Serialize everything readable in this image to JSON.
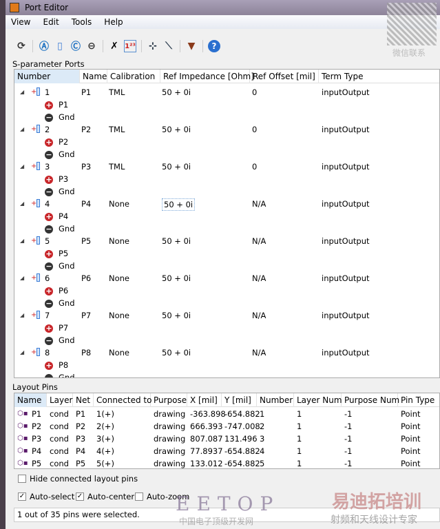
{
  "window": {
    "title": "Port Editor"
  },
  "menu": [
    "View",
    "Edit",
    "Tools",
    "Help"
  ],
  "toolbar": [
    "refresh-icon",
    "add-port-a-icon",
    "add-port-icon",
    "add-port-c-icon",
    "remove-port-icon",
    "delete-icon",
    "renumber-icon",
    "add-pin-icon",
    "remove-pin-icon",
    "filter-icon",
    "help-icon"
  ],
  "sparam": {
    "label": "S-parameter Ports",
    "columns": [
      "Number",
      "Name",
      "Calibration",
      "Ref Impedance [Ohm]",
      "Ref Offset [mil]",
      "Term Type"
    ],
    "ports": [
      {
        "number": "1",
        "name": "P1",
        "calibration": "TML",
        "impedance": "50 + 0i",
        "offset": "0",
        "term": "inputOutput",
        "plus": "P1",
        "minus": "Gnd"
      },
      {
        "number": "2",
        "name": "P2",
        "calibration": "TML",
        "impedance": "50 + 0i",
        "offset": "0",
        "term": "inputOutput",
        "plus": "P2",
        "minus": "Gnd"
      },
      {
        "number": "3",
        "name": "P3",
        "calibration": "TML",
        "impedance": "50 + 0i",
        "offset": "0",
        "term": "inputOutput",
        "plus": "P3",
        "minus": "Gnd"
      },
      {
        "number": "4",
        "name": "P4",
        "calibration": "None",
        "impedance": "50 + 0i",
        "offset": "N/A",
        "term": "inputOutput",
        "plus": "P4",
        "minus": "Gnd"
      },
      {
        "number": "5",
        "name": "P5",
        "calibration": "None",
        "impedance": "50 + 0i",
        "offset": "N/A",
        "term": "inputOutput",
        "plus": "P5",
        "minus": "Gnd"
      },
      {
        "number": "6",
        "name": "P6",
        "calibration": "None",
        "impedance": "50 + 0i",
        "offset": "N/A",
        "term": "inputOutput",
        "plus": "P6",
        "minus": "Gnd"
      },
      {
        "number": "7",
        "name": "P7",
        "calibration": "None",
        "impedance": "50 + 0i",
        "offset": "N/A",
        "term": "inputOutput",
        "plus": "P7",
        "minus": "Gnd"
      },
      {
        "number": "8",
        "name": "P8",
        "calibration": "None",
        "impedance": "50 + 0i",
        "offset": "N/A",
        "term": "inputOutput",
        "plus": "P8",
        "minus": "Gnd"
      }
    ]
  },
  "pins": {
    "label": "Layout Pins",
    "columns": [
      "Name",
      "Layer",
      "Net",
      "Connected to",
      "Purpose",
      "X [mil]",
      "Y [mil]",
      "Number",
      "Layer Num",
      "Purpose Num",
      "Pin Type"
    ],
    "rows": [
      [
        "P1",
        "cond",
        "P1",
        "1(+)",
        "drawing",
        "-363.898",
        "-654.882",
        "1",
        "1",
        "-1",
        "Point"
      ],
      [
        "P2",
        "cond",
        "P2",
        "2(+)",
        "drawing",
        "666.393",
        "-747.008",
        "2",
        "1",
        "-1",
        "Point"
      ],
      [
        "P3",
        "cond",
        "P3",
        "3(+)",
        "drawing",
        "807.087",
        "131.496",
        "3",
        "1",
        "-1",
        "Point"
      ],
      [
        "P4",
        "cond",
        "P4",
        "4(+)",
        "drawing",
        "77.8937",
        "-654.882",
        "4",
        "1",
        "-1",
        "Point"
      ],
      [
        "P5",
        "cond",
        "P5",
        "5(+)",
        "drawing",
        "133.012",
        "-654.882",
        "5",
        "1",
        "-1",
        "Point"
      ]
    ]
  },
  "options": {
    "hide_connected": {
      "label": "Hide connected layout pins",
      "checked": false
    },
    "auto_select": {
      "label": "Auto-select",
      "checked": true
    },
    "auto_center": {
      "label": "Auto-center",
      "checked": true
    },
    "auto_zoom": {
      "label": "Auto-zoom",
      "checked": false
    }
  },
  "status": "1 out of 35 pins were selected.",
  "watermarks": {
    "eetop": "EETOP",
    "eetop_sub": "中国电子顶级开发网",
    "brand": "易迪拓培训",
    "brand_sub": "射频和天线设计专家",
    "qr": "微信联系"
  }
}
